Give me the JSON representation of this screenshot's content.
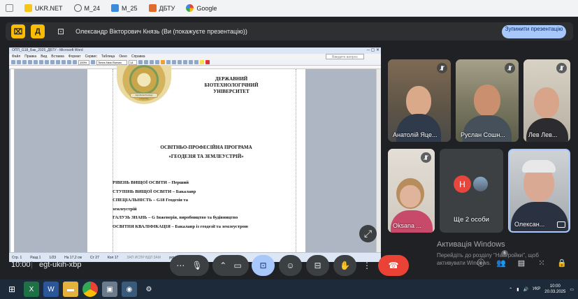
{
  "bookmarks": [
    {
      "label": "",
      "color": "#ffffff"
    },
    {
      "label": "UKR.NET",
      "color": "#f5c518"
    },
    {
      "label": "M_24",
      "color": "#5f6368"
    },
    {
      "label": "M_25",
      "color": "#3a8dde"
    },
    {
      "label": "ДБТУ",
      "color": "#e06b2c"
    },
    {
      "label": "Google",
      "color": "#4285f4"
    }
  ],
  "presenting": {
    "text": "Олександр Вікторович Князь (Ви (покажуєте презентацію))",
    "stop_label": "Зупинити презентацію"
  },
  "word": {
    "title": "ОПП_G18_Бак_2025_ДБТУ - Microsoft Word",
    "search_hint": "Введите вопрос",
    "menu": [
      "Файл",
      "Правка",
      "Вид",
      "Вставка",
      "Формат",
      "Сервис",
      "Таблица",
      "Окно",
      "Справка"
    ],
    "zoom": "100%",
    "font": "Times New Roman",
    "size": "14",
    "seal_text": "Agrobiotechnology University",
    "doc": {
      "university": [
        "ДЕРЖАВНИЙ",
        "БІОТЕХНОЛОГІЧНИЙ",
        "УНІВЕРСИТЕТ"
      ],
      "program": [
        "ОСВІТНЬО-ПРОФЕСІЙНА ПРОГРАМА",
        "«ГЕОДЕЗІЯ ТА ЗЕМЛЕУСТРІЙ»"
      ],
      "lines": [
        "РІВЕНЬ ВИЩОЇ ОСВІТИ – Перший",
        "СТУПІНЬ ВИЩОЇ ОСВІТИ – Бакалавр",
        "СПЕЦІАЛЬНІСТЬ – G18 Геодезія та",
        "землеустрій",
        "ГАЛУЗЬ ЗНАНЬ – G Інженерія, виробництво та будівництво",
        "ОСВІТНЯ КВАЛІФІКАЦІЯ – Бакалавр із геодезії та землеустрою"
      ]
    },
    "status": [
      "Стр. 1",
      "Разд 1",
      "1/23",
      "На 17,2 см",
      "Ст 27",
      "Кол 17",
      "ЗАП  ИСПР  ВДЛ  ЗАМ",
      "украинский"
    ]
  },
  "participants": [
    {
      "name": "Анатолій Яце...",
      "muted": true
    },
    {
      "name": "Руслан Сошн...",
      "muted": true
    },
    {
      "name": "Лев Лев...",
      "muted": true
    },
    {
      "name": "Oksana ...",
      "muted": true
    },
    {
      "name": "Ще 2 особи",
      "avatar_letter": "Н",
      "avatar_color": "#e8453c"
    },
    {
      "name": "Олексан...",
      "active": true
    }
  ],
  "meeting": {
    "time": "10:00",
    "code": "egt-ukih-xbp",
    "badge": "6"
  },
  "windows": {
    "line1": "Активація Windows",
    "line2": "Перейдіть до розділу \"Настройки\", щоб",
    "line3": "активувати Windows."
  },
  "taskbar": {
    "lang": "УКР",
    "time": "10:00",
    "date": "20.03.2025"
  }
}
